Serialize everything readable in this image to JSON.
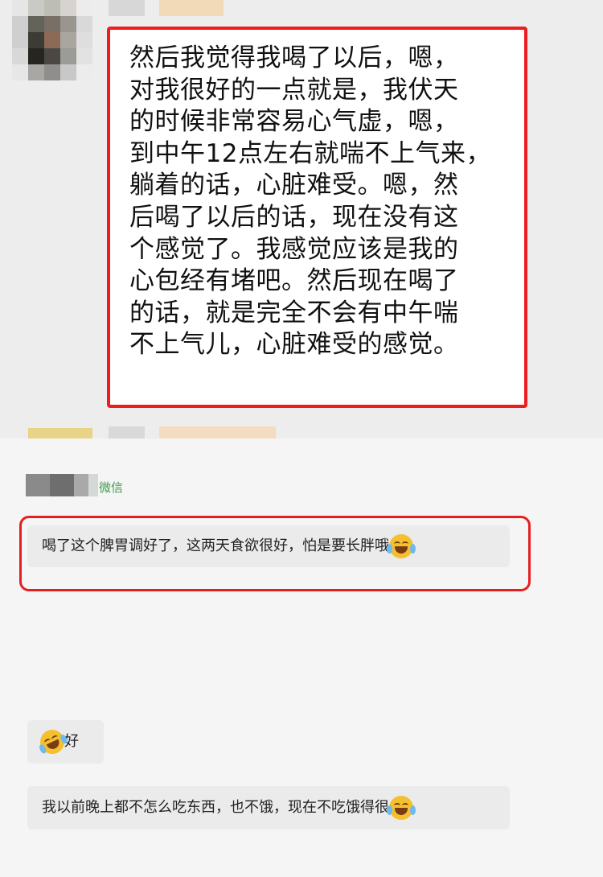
{
  "top_chat": {
    "quoted_message": "然后我觉得我喝了以后，嗯，\n对我很好的一点就是，我伏天\n的时候非常容易心气虚，嗯，\n到中午12点左右就喘不上气来，\n躺着的话，心脏难受。嗯，然\n后喝了以后的话，现在没有这\n个感觉了。我感觉应该是我的\n心包经有堵吧。然后现在喝了\n的话，就是完全不会有中午喘\n不上气儿，心脏难受的感觉。"
  },
  "bottom_chat": {
    "sender_source": "微信",
    "messages": [
      {
        "text": "喝了这个脾胃调好了，这两天食欲很好，怕是要长胖哦",
        "emoji": "tears-of-joy-emoji"
      },
      {
        "text": "好",
        "emoji": "rolling-laughing-emoji"
      },
      {
        "text": "我以前晚上都不怎么吃东西，也不饿，现在不吃饿得很",
        "emoji": "tears-of-joy-emoji"
      }
    ]
  },
  "colors": {
    "highlight": "#e51f1f",
    "bubble_gray": "#ebebeb",
    "wechat_green": "#3b9b4c"
  }
}
